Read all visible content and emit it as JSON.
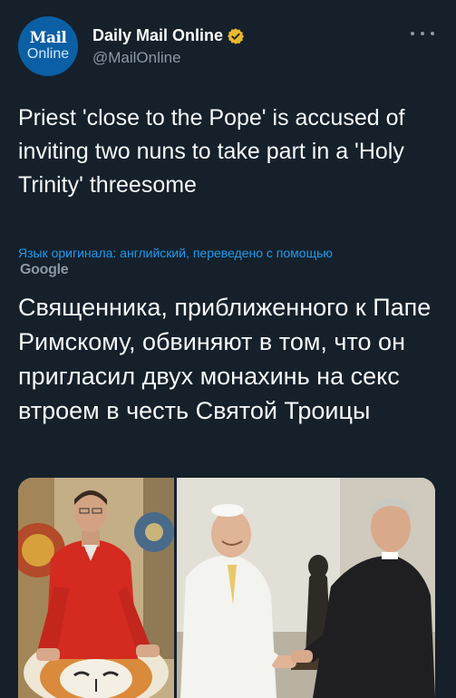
{
  "author": {
    "avatar_line1": "Mail",
    "avatar_line2": "Online",
    "display_name": "Daily Mail Online",
    "handle": "@MailOnline",
    "verified": true
  },
  "tweet": {
    "text": "Priest 'close to the Pope' is accused of inviting two nuns to take part in a 'Holy Trinity' threesome",
    "translation_note": "Язык оригинала: английский, переведено с помощью",
    "translation_provider": "Google",
    "translated_text": "Священника, приближенного к Папе Римскому, обвиняют в том, что он пригласил двух монахинь на секс втроем в честь Святой Троицы"
  },
  "media": {
    "count": 2,
    "items": [
      {
        "name": "photo-priest-with-mosaic"
      },
      {
        "name": "photo-pope-handshake"
      }
    ]
  },
  "icons": {
    "verified": "verified-badge-icon",
    "more": "more-options-icon"
  },
  "colors": {
    "background": "#15202b",
    "text": "#f7f9f9",
    "secondary": "#8b98a5",
    "link": "#1d9bf0",
    "verified_badge": "#e8b82d"
  }
}
